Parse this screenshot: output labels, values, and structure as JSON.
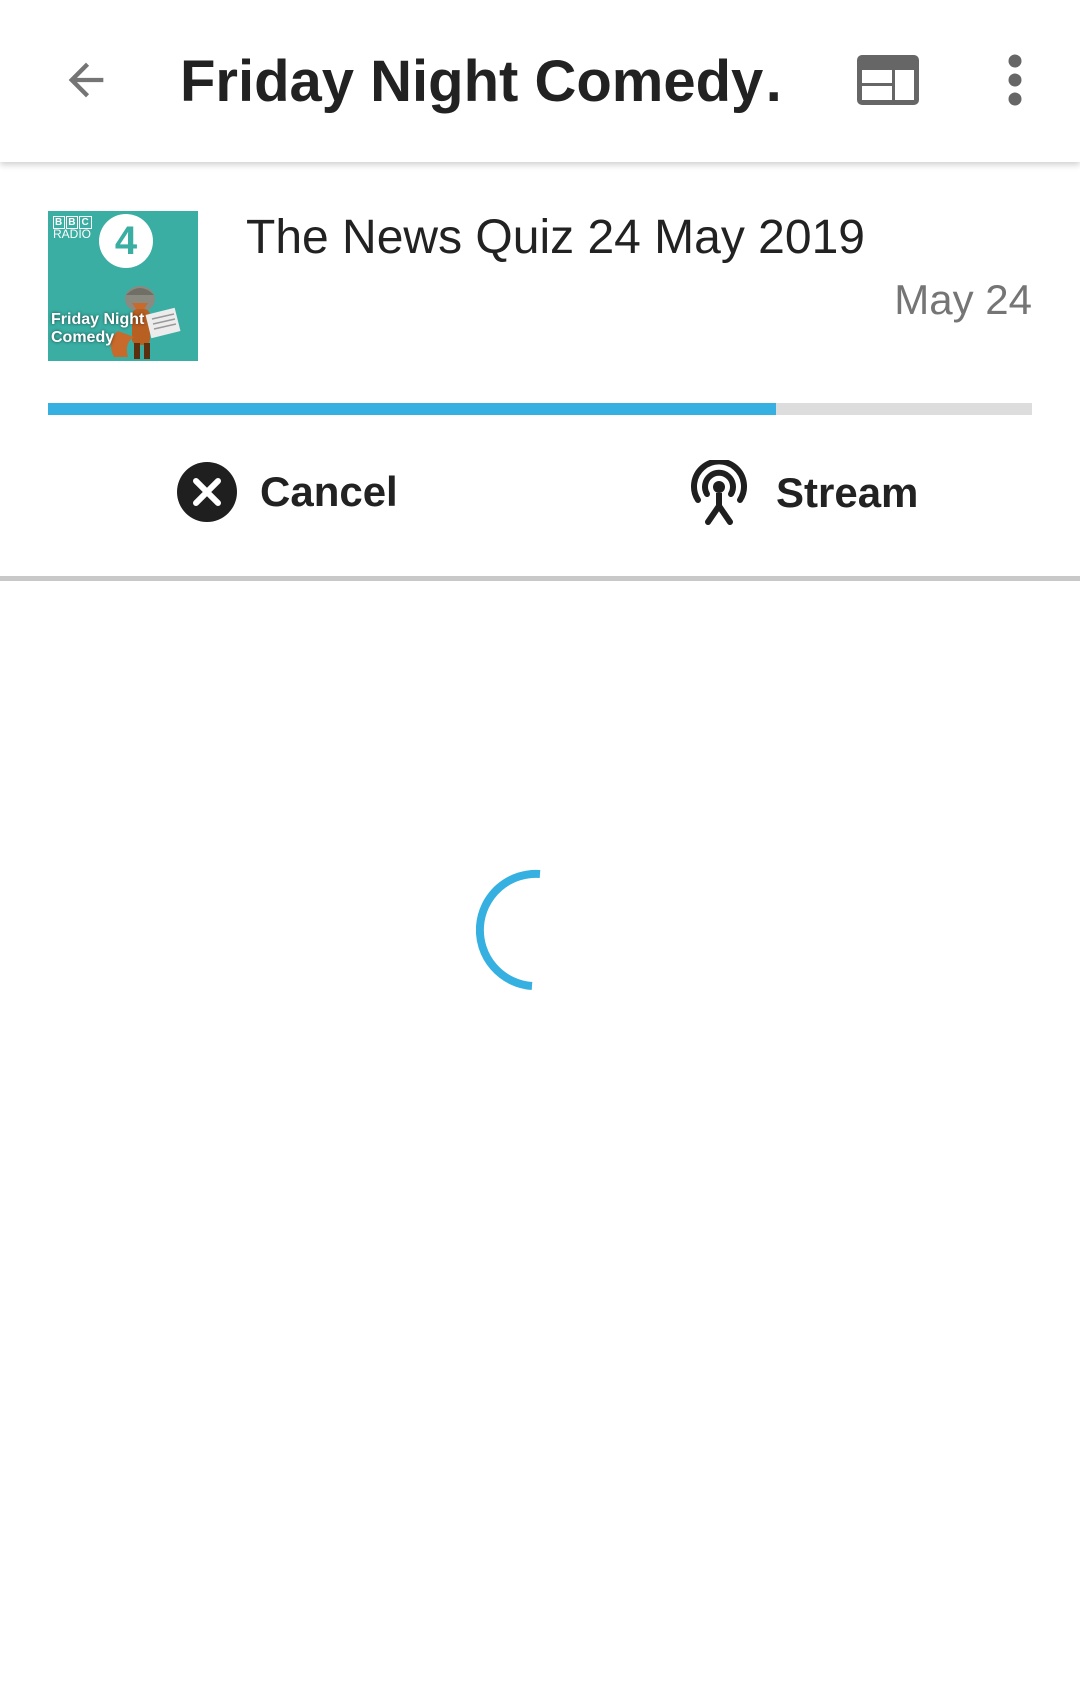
{
  "toolbar": {
    "title": "Friday Night Comedy…",
    "back_icon": "arrow-back-icon",
    "web_icon": "web-view-icon",
    "more_icon": "more-vert-icon"
  },
  "episode": {
    "cover": {
      "brand_line1": [
        "B",
        "B",
        "C"
      ],
      "brand_line2": "RADIO",
      "channel_number": "4",
      "show_name": "Friday Night Comedy"
    },
    "title": "The News Quiz 24 May 2019",
    "date": "May 24",
    "download_progress": 0.74
  },
  "actions": {
    "cancel_label": "Cancel",
    "cancel_icon": "cancel-circle-icon",
    "stream_label": "Stream",
    "stream_icon": "podcast-antenna-icon"
  },
  "loading": {
    "icon": "loading-spinner-icon"
  },
  "colors": {
    "accent": "#36b0e0",
    "cover_bg": "#3aaea3",
    "track": "#dddddd",
    "text_primary": "#222222",
    "text_secondary": "#757575"
  }
}
